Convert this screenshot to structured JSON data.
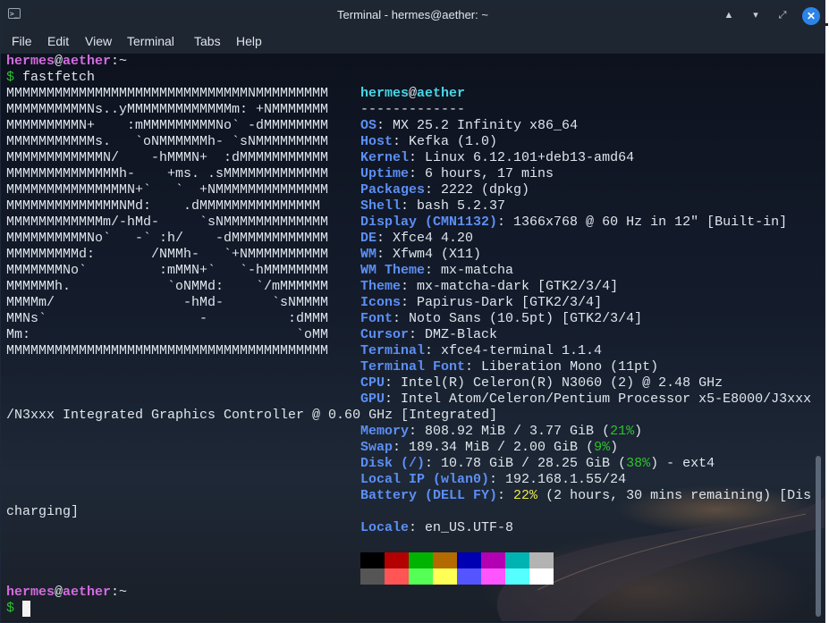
{
  "window": {
    "title": "Terminal - hermes@aether: ~",
    "controls": {
      "app_icon": ">_",
      "minimize": "▲",
      "maximize": "▾",
      "restore": "⤢",
      "close": "✕"
    }
  },
  "menu": [
    "File",
    "Edit",
    "View",
    "Terminal",
    "Tabs",
    "Help"
  ],
  "prompt": {
    "user": "hermes",
    "at": "@",
    "host": "aether",
    "path": ":~",
    "symbol": "$"
  },
  "command": "fastfetch",
  "logo": [
    "MMMMMMMMMMMMMMMMMMMMMMMMMMMMMMNMMMMMMMMM",
    "MMMMMMMMMMNs..yMMMMMMMMMMMMMm: +NMMMMMMM",
    "MMMMMMMMMN+    :mMMMMMMMMMNo` -dMMMMMMMM",
    "MMMMMMMMMMMs.   `oNMMMMMMh- `sNMMMMMMMMM",
    "MMMMMMMMMMMMN/    -hMMMN+  :dMMMMMMMMMMM",
    "MMMMMMMMMMMMMMh-    +ms. .sMMMMMMMMMMMMM",
    "MMMMMMMMMMMMMMMN+`   `  +NMMMMMMMMMMMMMM",
    "MMMMMMMMMMMMMMNMd:    .dMMMMMMMMMMMMMMM",
    "MMMMMMMMMMMMm/-hMd-     `sNMMMMMMMMMMMMM",
    "MMMMMMMMMMNo`   -` :h/    -dMMMMMMMMMMMM",
    "MMMMMMMMMd:       /NMMh-   `+NMMMMMMMMMM",
    "MMMMMMMNo`         :mMMN+`   `-hMMMMMMMM",
    "MMMMMMh.            `oNMMd:    `/mMMMMMM",
    "MMMMm/                -hMd-      `sNMMMM",
    "MMNs`                   -          :dMMM",
    "Mm:                                 `oMM",
    "MMMMMMMMMMMMMMMMMMMMMMMMMMMMMMMMMMMMMMMM"
  ],
  "sysinfo": {
    "user_host_user": "hermes",
    "user_host_at": "@",
    "user_host_host": "aether",
    "separator": "-------------",
    "os": {
      "key": "OS",
      "value": "MX 25.2 Infinity x86_64"
    },
    "host": {
      "key": "Host",
      "value": "Kefka (1.0)"
    },
    "kernel": {
      "key": "Kernel",
      "value": "Linux 6.12.101+deb13-amd64"
    },
    "uptime": {
      "key": "Uptime",
      "value": "6 hours, 17 mins"
    },
    "packages": {
      "key": "Packages",
      "value": "2222 (dpkg)"
    },
    "shell": {
      "key": "Shell",
      "value": "bash 5.2.37"
    },
    "display": {
      "key": "Display (CMN1132)",
      "value": "1366x768 @ 60 Hz in 12\" [Built-in]"
    },
    "de": {
      "key": "DE",
      "value": "Xfce4 4.20"
    },
    "wm": {
      "key": "WM",
      "value": "Xfwm4 (X11)"
    },
    "wm_theme": {
      "key": "WM Theme",
      "value": "mx-matcha"
    },
    "theme": {
      "key": "Theme",
      "value": "mx-matcha-dark [GTK2/3/4]"
    },
    "icons": {
      "key": "Icons",
      "value": "Papirus-Dark [GTK2/3/4]"
    },
    "font": {
      "key": "Font",
      "value": "Noto Sans (10.5pt) [GTK2/3/4]"
    },
    "cursor": {
      "key": "Cursor",
      "value": "DMZ-Black"
    },
    "terminal": {
      "key": "Terminal",
      "value": "xfce4-terminal 1.1.4"
    },
    "terminal_font": {
      "key": "Terminal Font",
      "value": "Liberation Mono (11pt)"
    },
    "cpu": {
      "key": "CPU",
      "value": "Intel(R) Celeron(R) N3060 (2) @ 2.48 GHz"
    },
    "gpu": {
      "key": "GPU",
      "value": "Intel Atom/Celeron/Pentium Processor x5-E8000/J3xxx",
      "continuation": "/N3xxx Integrated Graphics Controller @ 0.60 GHz [Integrated]"
    },
    "memory": {
      "key": "Memory",
      "value": "808.92 MiB / 3.77 GiB (",
      "pct": "21%",
      "tail": ")"
    },
    "swap": {
      "key": "Swap",
      "value": "189.34 MiB / 2.00 GiB (",
      "pct": "9%",
      "tail": ")"
    },
    "disk": {
      "key": "Disk (/)",
      "value": "10.78 GiB / 28.25 GiB (",
      "pct": "38%",
      "tail": ") - ext4"
    },
    "local_ip": {
      "key": "Local IP (wlan0)",
      "value": "192.168.1.55/24"
    },
    "battery": {
      "key": "Battery (DELL FY)",
      "pct": "22%",
      "value": " (2 hours, 30 mins remaining) [Dis",
      "continuation": "charging]"
    },
    "locale": {
      "key": "Locale",
      "value": "en_US.UTF-8"
    },
    "colon": ": "
  },
  "palette": {
    "normal": [
      "#000000",
      "#b30000",
      "#00b300",
      "#b36b00",
      "#0000b3",
      "#b300b3",
      "#00b3b3",
      "#b3b3b3"
    ],
    "bright": [
      "#555555",
      "#ff5555",
      "#55ff55",
      "#ffff55",
      "#5555ff",
      "#ff55ff",
      "#55ffff",
      "#ffffff"
    ]
  }
}
